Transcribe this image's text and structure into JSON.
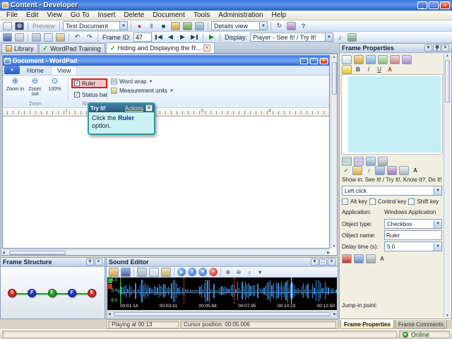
{
  "window": {
    "title": "Content - Developer",
    "status_online": "Online"
  },
  "menubar": {
    "items": [
      "File",
      "Edit",
      "View",
      "Go To",
      "Insert",
      "Delete",
      "Document",
      "Tools",
      "Administration",
      "Help"
    ]
  },
  "toolbar_top": {
    "preview_label": "Preview",
    "document_combo_value": "Test Document",
    "view_combo_value": "Details view"
  },
  "toolbar_frame": {
    "frame_id_label": "Frame ID:",
    "frame_id_value": "47",
    "display_label": "Display:",
    "display_combo_value": "Player - See It! / Try It!"
  },
  "document_tabs": {
    "library": "Library",
    "wordpad_training": "WordPad Training",
    "active_tab": "Hiding and Displaying the R..."
  },
  "wordpad": {
    "title": "Document - WordPad",
    "tab_home": "Home",
    "tab_view": "View",
    "zoom_in": "Zoom in",
    "zoom_out": "Zoom out",
    "zoom_100": "100%",
    "group_zoom": "Zoom",
    "group_show": "Show",
    "ruler": "Ruler",
    "status_bar": "Status bar",
    "word_wrap": "Word wrap",
    "measurement_units": "Measurement units",
    "ruler_numbers": [
      "1",
      "2",
      "3",
      "4"
    ]
  },
  "callout": {
    "title": "Try It!",
    "actions_link": "Actions",
    "text_before": "Click the ",
    "text_target": "Ruler",
    "text_after": " option."
  },
  "frame_structure": {
    "title": "Frame Structure",
    "nodes": [
      {
        "label": "S",
        "color": "#dd2222"
      },
      {
        "label": "F",
        "color": "#2233cc"
      },
      {
        "label": "F",
        "color": "#22a022"
      },
      {
        "label": "F",
        "color": "#2233cc"
      },
      {
        "label": "E",
        "color": "#dd2222"
      }
    ]
  },
  "sound_editor": {
    "title": "Sound Editor",
    "scale_top": "5.0",
    "scale_mid": "0.0",
    "scale_bottom": "-5.0",
    "times": [
      "00:01.14",
      "00:03.41",
      "00:05.68",
      "00:07.95",
      "00:10.23",
      "00:12.50"
    ],
    "status_playing": "Playing at 00:13",
    "status_cursor": "Cursor position: 00:05.006"
  },
  "frame_properties": {
    "title": "Frame Properties",
    "show_in_label": "Show in:",
    "show_in_value": "See It! / Try It!, Know It?, Do It!",
    "click_combo_value": "Left click",
    "alt_key": "Alt key",
    "control_key": "Control key",
    "shift_key": "Shift key",
    "application_label": "Application:",
    "application_value": "Windows Application",
    "object_type_label": "Object type:",
    "object_type_value": "Checkbox",
    "object_name_label": "Object name:",
    "object_name_value": "Ruler",
    "delay_label": "Delay time (s):",
    "delay_value": "5.0",
    "jump_in_label": "Jump-in point:",
    "tab_properties": "Frame Properties",
    "tab_comments": "Frame Comments"
  }
}
